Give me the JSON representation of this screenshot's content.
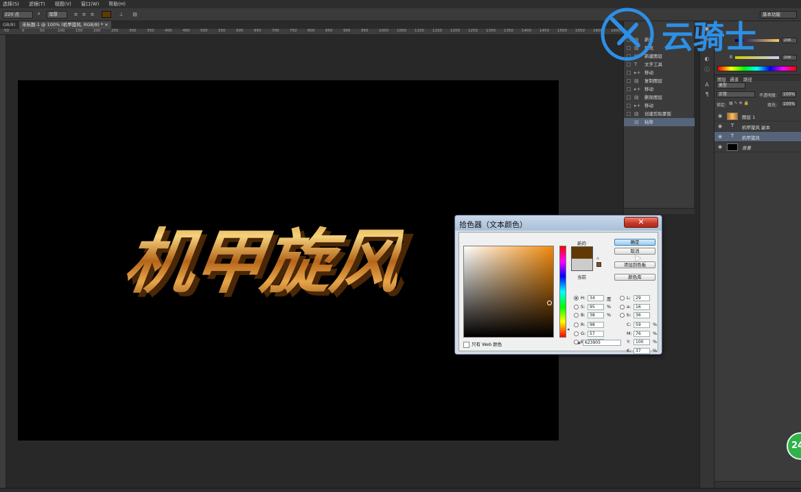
{
  "menu": [
    "选择(S)",
    "滤镜(T)",
    "视图(V)",
    "窗口(W)",
    "帮助(H)"
  ],
  "options": {
    "font_size": "220 点",
    "aa_mode": "浑厚",
    "text_color": "#623905",
    "workspace": "基本功能"
  },
  "tabs": {
    "left_partial": "GB/8)",
    "active": "未标题-1 @ 100% (机甲旋风, RGB/8) *"
  },
  "ruler_ticks": [
    "50",
    "0",
    "50",
    "100",
    "150",
    "200",
    "250",
    "300",
    "350",
    "400",
    "450",
    "500",
    "550",
    "600",
    "650",
    "700",
    "750",
    "800",
    "850",
    "900",
    "950",
    "1000",
    "1050",
    "1100",
    "1150",
    "1200",
    "1250",
    "1300",
    "1350",
    "1400",
    "1450",
    "1500",
    "1550",
    "1600",
    "1650",
    "1700",
    "1750",
    "1800",
    "1850",
    "1900"
  ],
  "canvas_text": "机甲旋风",
  "history": {
    "items": [
      {
        "label": "新建",
        "icon": "doc"
      },
      {
        "label": "填充",
        "icon": "doc"
      },
      {
        "label": "新建图层",
        "icon": "doc"
      },
      {
        "label": "文字工具",
        "icon": "text"
      },
      {
        "label": "移动",
        "icon": "move"
      },
      {
        "label": "复制图层",
        "icon": "doc"
      },
      {
        "label": "移动",
        "icon": "move"
      },
      {
        "label": "删除图层",
        "icon": "doc"
      },
      {
        "label": "移动",
        "icon": "move"
      },
      {
        "label": "创建剪贴蒙版",
        "icon": "doc"
      },
      {
        "label": "粘移",
        "icon": "doc"
      }
    ]
  },
  "color_panel": {
    "v1": "206",
    "v2": "206",
    "row2_label": "B"
  },
  "layers": {
    "tabs": [
      "图层",
      "通道",
      "路径"
    ],
    "filter": "类型",
    "blend_mode": "正常",
    "opacity_label": "不透明度:",
    "opacity": "100%",
    "lock_label": "锁定:",
    "fill_label": "填充:",
    "fill": "100%",
    "items": [
      {
        "name": "图层 1",
        "thumb": "img"
      },
      {
        "name": "机甲旋风 副本",
        "thumb": "T"
      },
      {
        "name": "机甲旋风",
        "thumb": "T"
      },
      {
        "name": "背景",
        "thumb": "bg"
      }
    ]
  },
  "watermark": "云骑士",
  "picker": {
    "title": "拾色器（文本颜色）",
    "close_symbol": "✕",
    "new_label": "新的",
    "current_label": "当前",
    "new_color": "#623905",
    "current_color": "#cccccc",
    "buttons": {
      "ok": "确定",
      "cancel": "取消",
      "add_swatch": "添加到色板",
      "libraries": "颜色库"
    },
    "hsb": [
      {
        "k": "H:",
        "v": "34",
        "u": "度",
        "selected": true
      },
      {
        "k": "S:",
        "v": "95",
        "u": "%",
        "selected": false
      },
      {
        "k": "B:",
        "v": "38",
        "u": "%",
        "selected": false
      }
    ],
    "rgb": [
      {
        "k": "R:",
        "v": "98"
      },
      {
        "k": "G:",
        "v": "57"
      },
      {
        "k": "B:",
        "v": "5"
      }
    ],
    "lab": [
      {
        "k": "L:",
        "v": "29"
      },
      {
        "k": "a:",
        "v": "16"
      },
      {
        "k": "b:",
        "v": "36"
      }
    ],
    "cmyk": [
      {
        "k": "C:",
        "v": "59",
        "u": "%"
      },
      {
        "k": "M:",
        "v": "76",
        "u": "%"
      },
      {
        "k": "Y:",
        "v": "100",
        "u": "%"
      },
      {
        "k": "K:",
        "v": "37",
        "u": "%"
      }
    ],
    "hex_label": "#",
    "hex": "623905",
    "web_only": "只有 Web 颜色"
  },
  "badge": "24"
}
